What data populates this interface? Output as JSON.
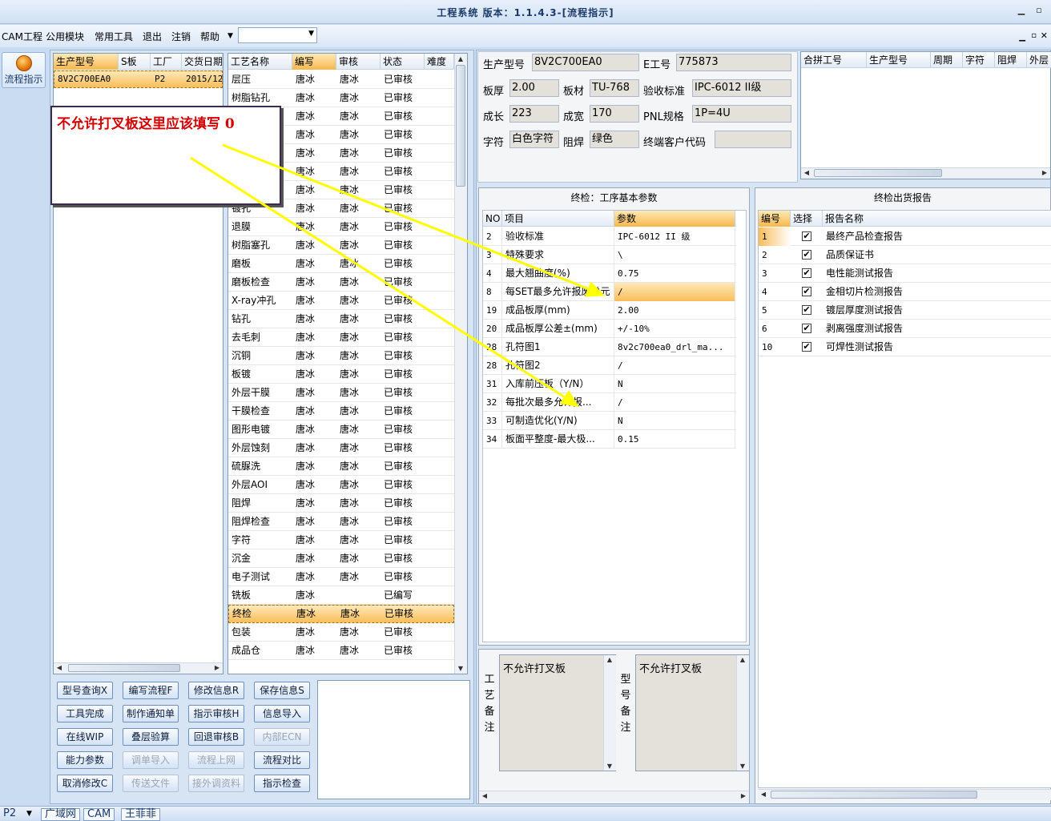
{
  "window": {
    "title": "工程系统 版本：1.1.4.3-[流程指示]"
  },
  "menu": {
    "items": [
      "CAM工程",
      "公用模块",
      "常用工具",
      "退出",
      "注销",
      "帮助"
    ],
    "combo_value": ""
  },
  "sidebar": {
    "flow_button": "流程指示"
  },
  "model_list": {
    "columns": [
      "生产型号",
      "S板",
      "工厂",
      "交货日期"
    ],
    "rows": [
      [
        "8V2C700EA0",
        "",
        "P2",
        "2015/12"
      ]
    ]
  },
  "process_list": {
    "columns": [
      "工艺名称",
      "编写",
      "审核",
      "状态",
      "难度"
    ],
    "rows": [
      [
        "层压",
        "唐冰",
        "唐冰",
        "已审核"
      ],
      [
        "树脂钻孔",
        "唐冰",
        "唐冰",
        "已审核"
      ],
      [
        "",
        "唐冰",
        "唐冰",
        "已审核"
      ],
      [
        "",
        "唐冰",
        "唐冰",
        "已审核"
      ],
      [
        "",
        "唐冰",
        "唐冰",
        "已审核"
      ],
      [
        "",
        "唐冰",
        "唐冰",
        "已审核"
      ],
      [
        "",
        "唐冰",
        "唐冰",
        "已审核"
      ],
      [
        "镀孔",
        "唐冰",
        "唐冰",
        "已审核"
      ],
      [
        "退膜",
        "唐冰",
        "唐冰",
        "已审核"
      ],
      [
        "树脂塞孔",
        "唐冰",
        "唐冰",
        "已审核"
      ],
      [
        "磨板",
        "唐冰",
        "唐冰",
        "已审核"
      ],
      [
        "磨板检查",
        "唐冰",
        "唐冰",
        "已审核"
      ],
      [
        "X-ray冲孔",
        "唐冰",
        "唐冰",
        "已审核"
      ],
      [
        "钻孔",
        "唐冰",
        "唐冰",
        "已审核"
      ],
      [
        "去毛刺",
        "唐冰",
        "唐冰",
        "已审核"
      ],
      [
        "沉铜",
        "唐冰",
        "唐冰",
        "已审核"
      ],
      [
        "板镀",
        "唐冰",
        "唐冰",
        "已审核"
      ],
      [
        "外层干膜",
        "唐冰",
        "唐冰",
        "已审核"
      ],
      [
        "干膜检查",
        "唐冰",
        "唐冰",
        "已审核"
      ],
      [
        "图形电镀",
        "唐冰",
        "唐冰",
        "已审核"
      ],
      [
        "外层蚀刻",
        "唐冰",
        "唐冰",
        "已审核"
      ],
      [
        "硫脲洗",
        "唐冰",
        "唐冰",
        "已审核"
      ],
      [
        "外层AOI",
        "唐冰",
        "唐冰",
        "已审核"
      ],
      [
        "阻焊",
        "唐冰",
        "唐冰",
        "已审核"
      ],
      [
        "阻焊检查",
        "唐冰",
        "唐冰",
        "已审核"
      ],
      [
        "字符",
        "唐冰",
        "唐冰",
        "已审核"
      ],
      [
        "沉金",
        "唐冰",
        "唐冰",
        "已审核"
      ],
      [
        "电子测试",
        "唐冰",
        "唐冰",
        "已审核"
      ],
      [
        "铣板",
        "唐冰",
        "",
        "已编写"
      ],
      [
        "终检",
        "唐冰",
        "唐冰",
        "已审核"
      ],
      [
        "包装",
        "唐冰",
        "唐冰",
        "已审核"
      ],
      [
        "成品仓",
        "唐冰",
        "唐冰",
        "已审核"
      ]
    ],
    "selected_index": 29
  },
  "buttons": [
    [
      "型号查询X",
      "编写流程F",
      "修改信息R",
      "保存信息S"
    ],
    [
      "工具完成",
      "制作通知单",
      "指示审核H",
      "信息导入"
    ],
    [
      "在线WIP",
      "叠层验算",
      "回退审核B",
      "内部ECN"
    ],
    [
      "能力参数",
      "调单导入",
      "流程上网",
      "流程对比"
    ],
    [
      "取消修改C",
      "传送文件",
      "接外调资料",
      "指示检查"
    ]
  ],
  "info": {
    "model_label": "生产型号",
    "model_value": "8V2C700EA0",
    "eno_label": "E工号",
    "eno_value": "775873",
    "thickness_label": "板厚",
    "thickness_value": "2.00",
    "material_label": "板材",
    "material_value": "TU-768",
    "standard_label": "验收标准",
    "standard_value": "IPC-6012 II级",
    "length_label": "成长",
    "length_value": "223",
    "width_label": "成宽",
    "width_value": "170",
    "pnl_label": "PNL规格",
    "pnl_value": "1P=4U",
    "char_label": "字符",
    "char_value": "白色字符",
    "mask_label": "阻焊",
    "mask_value": "绿色",
    "customer_label": "终端客户代码",
    "customer_value": ""
  },
  "merge_table": {
    "columns": [
      "合拼工号",
      "生产型号",
      "周期",
      "字符",
      "阻焊",
      "外层"
    ]
  },
  "params": {
    "title": "终检：工序基本参数",
    "columns": [
      "NO",
      "项目",
      "参数"
    ],
    "rows": [
      [
        "2",
        "验收标准",
        "IPC-6012 II 级"
      ],
      [
        "3",
        "特殊要求",
        "\\"
      ],
      [
        "4",
        "最大翘曲度(%)",
        "0.75"
      ],
      [
        "8",
        "每SET最多允许报废单元",
        "/"
      ],
      [
        "19",
        "成品板厚(mm)",
        "2.00"
      ],
      [
        "20",
        "成品板厚公差±(mm)",
        "+/-10%"
      ],
      [
        "28",
        "孔符图1",
        "8v2c700ea0_drl_ma..."
      ],
      [
        "28",
        "孔符图2",
        "/"
      ],
      [
        "31",
        "入库前压板（Y/N）",
        "N"
      ],
      [
        "32",
        "每批次最多允许报...",
        "/"
      ],
      [
        "33",
        "可制造优化(Y/N)",
        "N"
      ],
      [
        "34",
        "板面平整度-最大极...",
        "0.15"
      ]
    ],
    "selected_index": 3
  },
  "report": {
    "title": "终检出货报告",
    "columns": [
      "编号",
      "选择",
      "报告名称"
    ],
    "rows": [
      [
        "1",
        "最终产品检查报告"
      ],
      [
        "2",
        "品质保证书"
      ],
      [
        "3",
        "电性能测试报告"
      ],
      [
        "4",
        "金相切片检测报告"
      ],
      [
        "5",
        "镀层厚度测试报告"
      ],
      [
        "6",
        "剥离强度测试报告"
      ],
      [
        "10",
        "可焊性测试报告"
      ]
    ],
    "check_mark": "✔"
  },
  "remarks": {
    "process_label": "工艺备注",
    "process_text": "不允许打叉板",
    "model_label": "型号备注",
    "model_text": "不允许打叉板"
  },
  "statusbar": {
    "factory": "P2",
    "tabs": [
      "广域网",
      "CAM",
      "王菲菲"
    ]
  },
  "annotation": {
    "text": "不允许打叉板这里应该填写 0"
  },
  "colors": {
    "annotation_arrow": "#ffff00",
    "annotation_text": "#d40000",
    "selection": "#f9bd5a"
  }
}
